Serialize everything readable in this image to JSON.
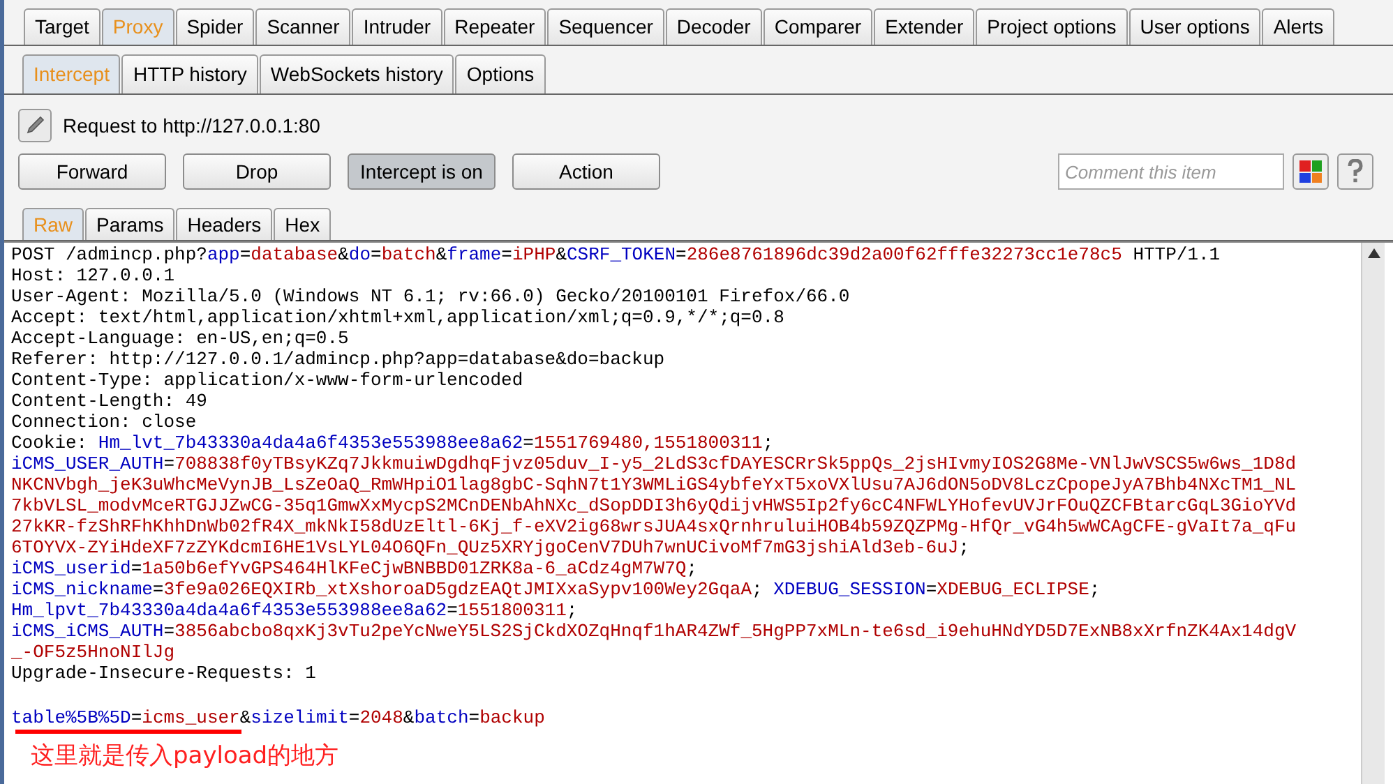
{
  "main_tabs": [
    {
      "label": "Target",
      "selected": false
    },
    {
      "label": "Proxy",
      "selected": true
    },
    {
      "label": "Spider",
      "selected": false
    },
    {
      "label": "Scanner",
      "selected": false
    },
    {
      "label": "Intruder",
      "selected": false
    },
    {
      "label": "Repeater",
      "selected": false
    },
    {
      "label": "Sequencer",
      "selected": false
    },
    {
      "label": "Decoder",
      "selected": false
    },
    {
      "label": "Comparer",
      "selected": false
    },
    {
      "label": "Extender",
      "selected": false
    },
    {
      "label": "Project options",
      "selected": false
    },
    {
      "label": "User options",
      "selected": false
    },
    {
      "label": "Alerts",
      "selected": false
    }
  ],
  "proxy_tabs": [
    {
      "label": "Intercept",
      "selected": true
    },
    {
      "label": "HTTP history",
      "selected": false
    },
    {
      "label": "WebSockets history",
      "selected": false
    },
    {
      "label": "Options",
      "selected": false
    }
  ],
  "request_target": "Request to http://127.0.0.1:80",
  "buttons": [
    {
      "label": "Forward",
      "pressed": false
    },
    {
      "label": "Drop",
      "pressed": false
    },
    {
      "label": "Intercept is on",
      "pressed": true
    },
    {
      "label": "Action",
      "pressed": false
    }
  ],
  "comment": {
    "placeholder": "Comment this item"
  },
  "editor_tabs": [
    {
      "label": "Raw",
      "selected": true
    },
    {
      "label": "Params",
      "selected": false
    },
    {
      "label": "Headers",
      "selected": false
    },
    {
      "label": "Hex",
      "selected": false
    }
  ],
  "header_lines": [
    {
      "segments": [
        {
          "kind": "plain",
          "text": "POST /admincp.php?"
        },
        {
          "kind": "name",
          "text": "app"
        },
        {
          "kind": "plain",
          "text": "="
        },
        {
          "kind": "value",
          "text": "database"
        },
        {
          "kind": "plain",
          "text": "&"
        },
        {
          "kind": "name",
          "text": "do"
        },
        {
          "kind": "plain",
          "text": "="
        },
        {
          "kind": "value",
          "text": "batch"
        },
        {
          "kind": "plain",
          "text": "&"
        },
        {
          "kind": "name",
          "text": "frame"
        },
        {
          "kind": "plain",
          "text": "="
        },
        {
          "kind": "value",
          "text": "iPHP"
        },
        {
          "kind": "plain",
          "text": "&"
        },
        {
          "kind": "name",
          "text": "CSRF_TOKEN"
        },
        {
          "kind": "plain",
          "text": "="
        },
        {
          "kind": "value",
          "text": "286e8761896dc39d2a00f62fffe32273cc1e78c5"
        },
        {
          "kind": "plain",
          "text": " HTTP/1.1"
        }
      ]
    },
    {
      "segments": [
        {
          "kind": "plain",
          "text": "Host: 127.0.0.1"
        }
      ]
    },
    {
      "segments": [
        {
          "kind": "plain",
          "text": "User-Agent: Mozilla/5.0 (Windows NT 6.1; rv:66.0) Gecko/20100101 Firefox/66.0"
        }
      ]
    },
    {
      "segments": [
        {
          "kind": "plain",
          "text": "Accept: text/html,application/xhtml+xml,application/xml;q=0.9,*/*;q=0.8"
        }
      ]
    },
    {
      "segments": [
        {
          "kind": "plain",
          "text": "Accept-Language: en-US,en;q=0.5"
        }
      ]
    },
    {
      "segments": [
        {
          "kind": "plain",
          "text": "Referer: http://127.0.0.1/admincp.php?app=database&do=backup"
        }
      ]
    },
    {
      "segments": [
        {
          "kind": "plain",
          "text": "Content-Type: application/x-www-form-urlencoded"
        }
      ]
    },
    {
      "segments": [
        {
          "kind": "plain",
          "text": "Content-Length: 49"
        }
      ]
    },
    {
      "segments": [
        {
          "kind": "plain",
          "text": "Connection: close"
        }
      ]
    },
    {
      "segments": [
        {
          "kind": "plain",
          "text": "Cookie: "
        },
        {
          "kind": "name",
          "text": "Hm_lvt_7b43330a4da4a6f4353e553988ee8a62"
        },
        {
          "kind": "plain",
          "text": "="
        },
        {
          "kind": "value",
          "text": "1551769480,1551800311"
        },
        {
          "kind": "plain",
          "text": ";"
        }
      ]
    },
    {
      "segments": [
        {
          "kind": "name",
          "text": "iCMS_USER_AUTH"
        },
        {
          "kind": "plain",
          "text": "="
        },
        {
          "kind": "value",
          "text": "708838f0yTBsyKZq7JkkmuiwDgdhqFjvz05duv_I-y5_2LdS3cfDAYESCRrSk5ppQs_2jsHIvmyIOS2G8Me-VNlJwVSCS5w6ws_1D8d"
        }
      ]
    },
    {
      "segments": [
        {
          "kind": "value",
          "text": "NKCNVbgh_jeK3uWhcMeVynJB_LsZeOaQ_RmWHpiO1lag8gbC-SqhN7t1Y3WMLiGS4ybfeYxT5xoVXlUsu7AJ6dON5oDV8LczCpopeJyA7Bhb4NXcTM1_NL"
        }
      ]
    },
    {
      "segments": [
        {
          "kind": "value",
          "text": "7kbVLSL_modvMceRTGJJZwCG-35q1GmwXxMycpS2MCnDENbAhNXc_dSopDDI3h6yQdijvHWS5Ip2fy6cC4NFWLYHofevUVJrFOuQZCFBtarcGqL3GioYVd"
        }
      ]
    },
    {
      "segments": [
        {
          "kind": "value",
          "text": "27kKR-fzShRFhKhhDnWb02fR4X_mkNkI58dUzEltl-6Kj_f-eXV2ig68wrsJUA4sxQrnhruluiHOB4b59ZQZPMg-HfQr_vG4h5wWCAgCFE-gVaIt7a_qFu"
        }
      ]
    },
    {
      "segments": [
        {
          "kind": "value",
          "text": "6TOYVX-ZYiHdeXF7zZYKdcmI6HE1VsLYL04O6QFn_QUz5XRYjgoCenV7DUh7wnUCivoMf7mG3jshiAld3eb-6uJ"
        },
        {
          "kind": "plain",
          "text": ";"
        }
      ]
    },
    {
      "segments": [
        {
          "kind": "name",
          "text": "iCMS_userid"
        },
        {
          "kind": "plain",
          "text": "="
        },
        {
          "kind": "value",
          "text": "1a50b6efYvGPS464HlKFeCjwBNBBD01ZRK8a-6_aCdz4gM7W7Q"
        },
        {
          "kind": "plain",
          "text": ";"
        }
      ]
    },
    {
      "segments": [
        {
          "kind": "name",
          "text": "iCMS_nickname"
        },
        {
          "kind": "plain",
          "text": "="
        },
        {
          "kind": "value",
          "text": "3fe9a026EQXIRb_xtXshoroaD5gdzEAQtJMIXxaSypv100Wey2GqaA"
        },
        {
          "kind": "plain",
          "text": "; "
        },
        {
          "kind": "name",
          "text": "XDEBUG_SESSION"
        },
        {
          "kind": "plain",
          "text": "="
        },
        {
          "kind": "value",
          "text": "XDEBUG_ECLIPSE"
        },
        {
          "kind": "plain",
          "text": ";"
        }
      ]
    },
    {
      "segments": [
        {
          "kind": "name",
          "text": "Hm_lpvt_7b43330a4da4a6f4353e553988ee8a62"
        },
        {
          "kind": "plain",
          "text": "="
        },
        {
          "kind": "value",
          "text": "1551800311"
        },
        {
          "kind": "plain",
          "text": ";"
        }
      ]
    },
    {
      "segments": [
        {
          "kind": "name",
          "text": "iCMS_iCMS_AUTH"
        },
        {
          "kind": "plain",
          "text": "="
        },
        {
          "kind": "value",
          "text": "3856abcbo8qxKj3vTu2peYcNweY5LS2SjCkdXOZqHnqf1hAR4ZWf_5HgPP7xMLn-te6sd_i9ehuHNdYD5D7ExNB8xXrfnZK4Ax14dgV"
        }
      ]
    },
    {
      "segments": [
        {
          "kind": "value",
          "text": "_-OF5z5HnoNIlJg"
        }
      ]
    },
    {
      "segments": [
        {
          "kind": "plain",
          "text": "Upgrade-Insecure-Requests: 1"
        }
      ]
    }
  ],
  "body_line": {
    "segments": [
      {
        "kind": "name",
        "text": "table%5B%5D"
      },
      {
        "kind": "plain",
        "text": "="
      },
      {
        "kind": "value",
        "text": "icms_user"
      },
      {
        "kind": "plain",
        "text": "&"
      },
      {
        "kind": "name",
        "text": "sizelimit"
      },
      {
        "kind": "plain",
        "text": "="
      },
      {
        "kind": "value",
        "text": "2048"
      },
      {
        "kind": "plain",
        "text": "&"
      },
      {
        "kind": "name",
        "text": "batch"
      },
      {
        "kind": "plain",
        "text": "="
      },
      {
        "kind": "value",
        "text": "backup"
      }
    ]
  },
  "annotation": "这里就是传入payload的地方"
}
